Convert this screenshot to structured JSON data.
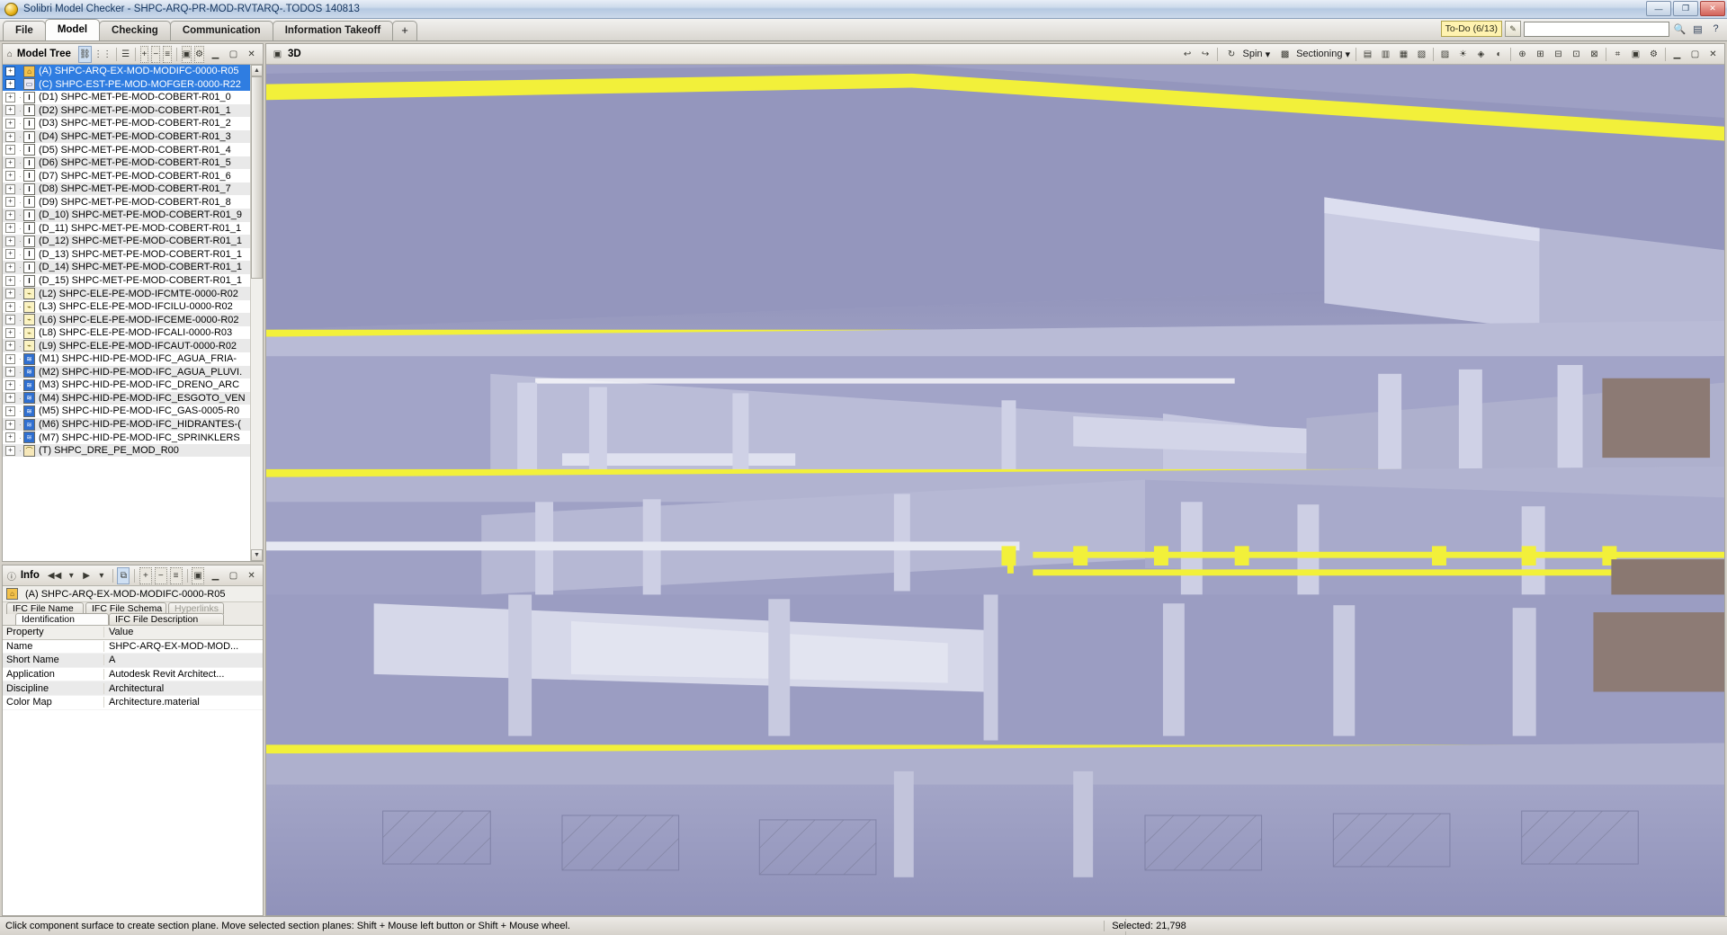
{
  "window": {
    "title": "Solibri Model Checker - SHPC-ARQ-PR-MOD-RVTARQ-.TODOS 140813",
    "minimize": "—",
    "maximize": "❐",
    "close": "✕"
  },
  "tabs": [
    {
      "label": "File",
      "active": false
    },
    {
      "label": "Model",
      "active": true
    },
    {
      "label": "Checking",
      "active": false
    },
    {
      "label": "Communication",
      "active": false
    },
    {
      "label": "Information Takeoff",
      "active": false
    },
    {
      "label": "+",
      "active": false
    }
  ],
  "todo": {
    "label": "To-Do (6/13)",
    "new_icon": "new-todo-icon",
    "input_value": "",
    "search_icon": "binoculars-icon",
    "film_icon": "film-icon",
    "help_icon": "help-icon"
  },
  "model_tree": {
    "title": "Model Tree",
    "home_icon": "house-icon",
    "tools": [
      "hierarchy-icon",
      "structure-icon",
      "layers-icon",
      "expand-icon",
      "collapse-icon",
      "list-icon",
      "panel-icon",
      "settings-icon"
    ],
    "items": [
      {
        "label": "(A) SHPC-ARQ-EX-MOD-MODIFC-0000-R05",
        "icon": "arq",
        "selected": true
      },
      {
        "label": "(C) SHPC-EST-PE-MOD-MOFGER-0000-R22",
        "icon": "est",
        "selected": true
      },
      {
        "label": "(D1) SHPC-MET-PE-MOD-COBERT-R01_0",
        "icon": "met",
        "selected": false
      },
      {
        "label": "(D2) SHPC-MET-PE-MOD-COBERT-R01_1",
        "icon": "met",
        "selected": false
      },
      {
        "label": "(D3) SHPC-MET-PE-MOD-COBERT-R01_2",
        "icon": "met",
        "selected": false
      },
      {
        "label": "(D4) SHPC-MET-PE-MOD-COBERT-R01_3",
        "icon": "met",
        "selected": false
      },
      {
        "label": "(D5) SHPC-MET-PE-MOD-COBERT-R01_4",
        "icon": "met",
        "selected": false
      },
      {
        "label": "(D6) SHPC-MET-PE-MOD-COBERT-R01_5",
        "icon": "met",
        "selected": false
      },
      {
        "label": "(D7) SHPC-MET-PE-MOD-COBERT-R01_6",
        "icon": "met",
        "selected": false
      },
      {
        "label": "(D8) SHPC-MET-PE-MOD-COBERT-R01_7",
        "icon": "met",
        "selected": false
      },
      {
        "label": "(D9) SHPC-MET-PE-MOD-COBERT-R01_8",
        "icon": "met",
        "selected": false
      },
      {
        "label": "(D_10) SHPC-MET-PE-MOD-COBERT-R01_9",
        "icon": "met",
        "selected": false
      },
      {
        "label": "(D_11) SHPC-MET-PE-MOD-COBERT-R01_1",
        "icon": "met",
        "selected": false
      },
      {
        "label": "(D_12) SHPC-MET-PE-MOD-COBERT-R01_1",
        "icon": "met",
        "selected": false
      },
      {
        "label": "(D_13) SHPC-MET-PE-MOD-COBERT-R01_1",
        "icon": "met",
        "selected": false
      },
      {
        "label": "(D_14) SHPC-MET-PE-MOD-COBERT-R01_1",
        "icon": "met",
        "selected": false
      },
      {
        "label": "(D_15) SHPC-MET-PE-MOD-COBERT-R01_1",
        "icon": "met",
        "selected": false
      },
      {
        "label": "(L2) SHPC-ELE-PE-MOD-IFCMTE-0000-R02",
        "icon": "ele",
        "selected": false
      },
      {
        "label": "(L3) SHPC-ELE-PE-MOD-IFCILU-0000-R02",
        "icon": "ele",
        "selected": false
      },
      {
        "label": "(L6) SHPC-ELE-PE-MOD-IFCEME-0000-R02",
        "icon": "ele",
        "selected": false
      },
      {
        "label": "(L8) SHPC-ELE-PE-MOD-IFCALI-0000-R03",
        "icon": "ele",
        "selected": false
      },
      {
        "label": "(L9) SHPC-ELE-PE-MOD-IFCAUT-0000-R02",
        "icon": "ele",
        "selected": false
      },
      {
        "label": "(M1) SHPC-HID-PE-MOD-IFC_AGUA_FRIA-",
        "icon": "hid",
        "selected": false
      },
      {
        "label": "(M2) SHPC-HID-PE-MOD-IFC_AGUA_PLUVI.",
        "icon": "hid",
        "selected": false
      },
      {
        "label": "(M3) SHPC-HID-PE-MOD-IFC_DRENO_ARC",
        "icon": "hid",
        "selected": false
      },
      {
        "label": "(M4) SHPC-HID-PE-MOD-IFC_ESGOTO_VEN",
        "icon": "hid",
        "selected": false
      },
      {
        "label": "(M5) SHPC-HID-PE-MOD-IFC_GAS-0005-R0",
        "icon": "hid",
        "selected": false
      },
      {
        "label": "(M6) SHPC-HID-PE-MOD-IFC_HIDRANTES-(",
        "icon": "hid2",
        "selected": false
      },
      {
        "label": "(M7) SHPC-HID-PE-MOD-IFC_SPRINKLERS",
        "icon": "hid2",
        "selected": false
      },
      {
        "label": "(T) SHPC_DRE_PE_MOD_R00",
        "icon": "dre",
        "selected": false
      }
    ]
  },
  "info": {
    "title": "Info",
    "icon": "info-icon",
    "nav_prev": "◀◀",
    "nav_prev_menu": "▾",
    "nav_next": "▶",
    "nav_next_menu": "▾",
    "object_label": "(A) SHPC-ARQ-EX-MOD-MODIFC-0000-R05",
    "object_icon": "arq-model-icon",
    "tabs_row1": [
      {
        "label": "IFC File Name",
        "active": false,
        "dim": false
      },
      {
        "label": "IFC File Schema",
        "active": false,
        "dim": false
      },
      {
        "label": "Hyperlinks",
        "active": false,
        "dim": true
      }
    ],
    "tabs_row2": [
      {
        "label": "Identification",
        "active": true,
        "dim": false
      },
      {
        "label": "IFC File Description",
        "active": false,
        "dim": false
      }
    ],
    "table": {
      "columns": [
        "Property",
        "Value"
      ],
      "rows": [
        [
          "Name",
          "SHPC-ARQ-EX-MOD-MOD..."
        ],
        [
          "Short Name",
          "A"
        ],
        [
          "Application",
          "Autodesk Revit Architect..."
        ],
        [
          "Discipline",
          "Architectural"
        ],
        [
          "Color Map",
          "Architecture.material"
        ]
      ]
    }
  },
  "view3d": {
    "title": "3D",
    "icon": "cube-icon",
    "undo_icon": "undo-arrow-icon",
    "redo_icon": "redo-arrow-icon",
    "spin_label": "Spin",
    "spin_icon": "spin-icon",
    "sectioning_label": "Sectioning",
    "sectioning_icon": "section-cube-icon",
    "dropdown_caret": "▾",
    "right_tools": [
      "box-icon",
      "walls-icon",
      "floors-icon",
      "room-icon",
      "grid-icon",
      "light-icon",
      "camera-icon",
      "shade-icon",
      "target-icon",
      "zoom-in-icon",
      "zoom-out-icon",
      "zoom-fit-icon",
      "zoom-area-icon",
      "measure-icon",
      "snapshot-icon",
      "settings-icon",
      "minimize-icon",
      "maximize-icon",
      "close-icon"
    ]
  },
  "status": {
    "message": "Click component surface to create section plane. Move selected section planes: Shift + Mouse left button or Shift + Mouse wheel.",
    "selected": "Selected: 21,798"
  }
}
